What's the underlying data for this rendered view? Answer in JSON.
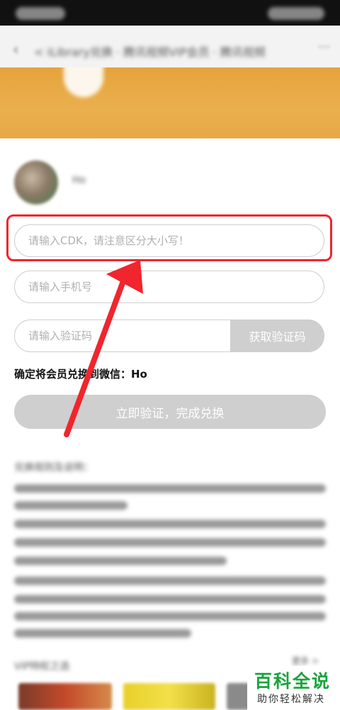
{
  "nav": {
    "title": "< iLibrary兑换 · 腾讯视频VIP会员 · 腾讯视频",
    "more_label": "···"
  },
  "user": {
    "name": "Ho"
  },
  "form": {
    "cdk_placeholder": "请输入CDK，请注意区分大小写！",
    "phone_placeholder": "请输入手机号",
    "code_placeholder": "请输入验证码",
    "get_code_label": "获取验证码",
    "redeem_note": "确定将会员兑换到微信：Ho",
    "submit_label": "立即验证，完成兑换"
  },
  "rules": {
    "title": "兑换规则及说明："
  },
  "vip": {
    "title": "VIP特权之选",
    "more": "更多 >"
  },
  "colors": {
    "accent": "#f0252d",
    "banner": "#e8a843",
    "disabled": "#cfcfcf",
    "watermark_green": "#19a33c"
  },
  "watermark": {
    "main": "百科全说",
    "sub": "助你轻松解决"
  }
}
